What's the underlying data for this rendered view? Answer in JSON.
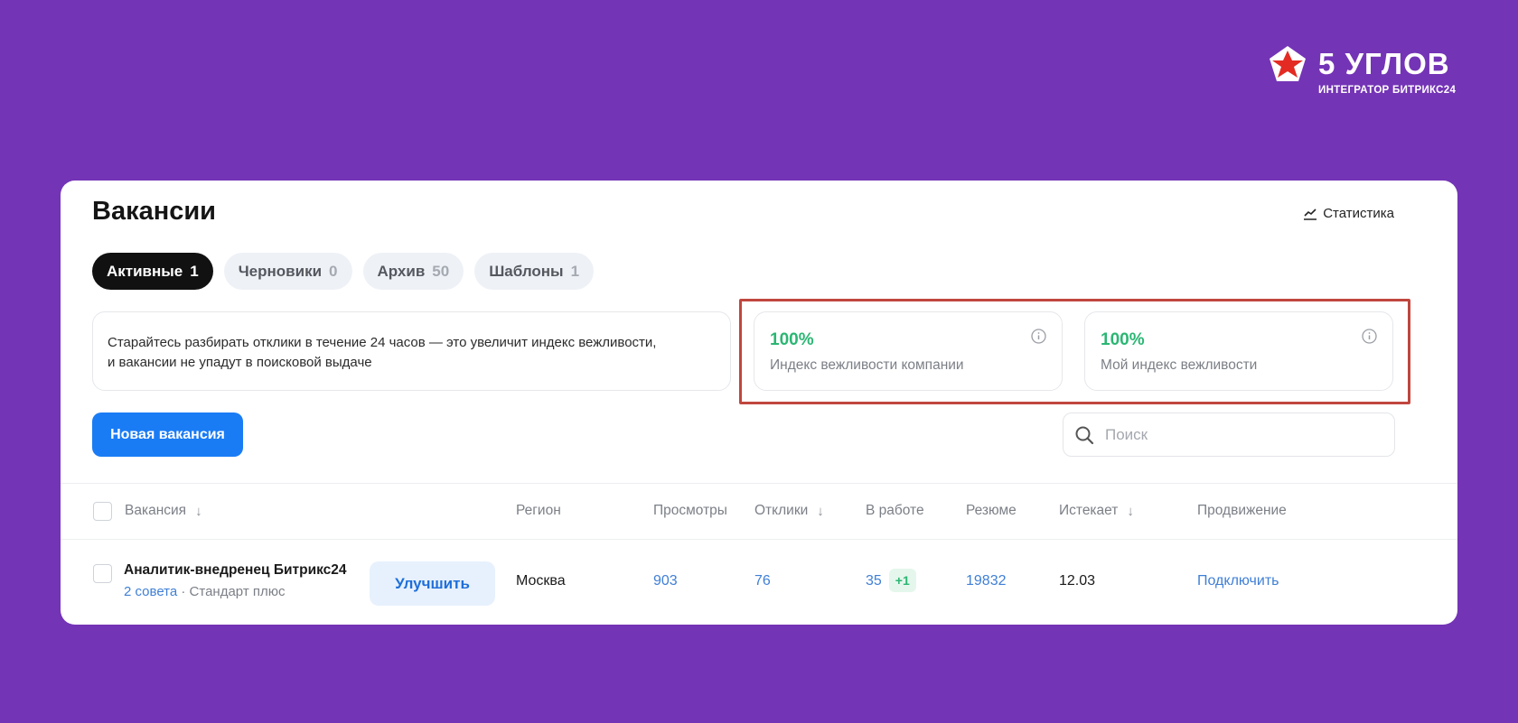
{
  "logo": {
    "title": "5 УГЛОВ",
    "subtitle": "ИНТЕГРАТОР БИТРИКС24",
    "icon": "pentagon-star-logo",
    "color": "#e32b24"
  },
  "page": {
    "title": "Вакансии",
    "stats_label": "Статистика"
  },
  "tabs": [
    {
      "label": "Активные",
      "count": "1",
      "active": true
    },
    {
      "label": "Черновики",
      "count": "0"
    },
    {
      "label": "Архив",
      "count": "50"
    },
    {
      "label": "Шаблоны",
      "count": "1"
    }
  ],
  "tip": {
    "line1": "Старайтесь разбирать отклики в течение 24 часов — это увеличит индекс вежливости,",
    "line2": "и вакансии не упадут в поисковой выдаче"
  },
  "indexes": [
    {
      "value": "100%",
      "label": "Индекс вежливости компании"
    },
    {
      "value": "100%",
      "label": "Мой индекс вежливости"
    }
  ],
  "actions": {
    "new_vacancy": "Новая вакансия",
    "search_placeholder": "Поиск"
  },
  "table": {
    "headers": {
      "vacancy": "Вакансия",
      "region": "Регион",
      "views": "Просмотры",
      "responses": "Отклики",
      "in_work": "В работе",
      "resume": "Резюме",
      "expires": "Истекает",
      "promotion": "Продвижение"
    },
    "rows": [
      {
        "title": "Аналитик-внедренец Битрикс24",
        "tips": "2 совета",
        "plan": " · Стандарт плюс",
        "improve": "Улучшить",
        "region": "Москва",
        "views": "903",
        "responses": "76",
        "in_work": "35",
        "in_work_badge": "+1",
        "resume": "19832",
        "expires": "12.03",
        "promotion": "Подключить"
      }
    ]
  },
  "colors": {
    "background": "#7434b6",
    "accent": "#1a7cf5",
    "success": "#2bb673",
    "highlight": "#c0463e"
  }
}
